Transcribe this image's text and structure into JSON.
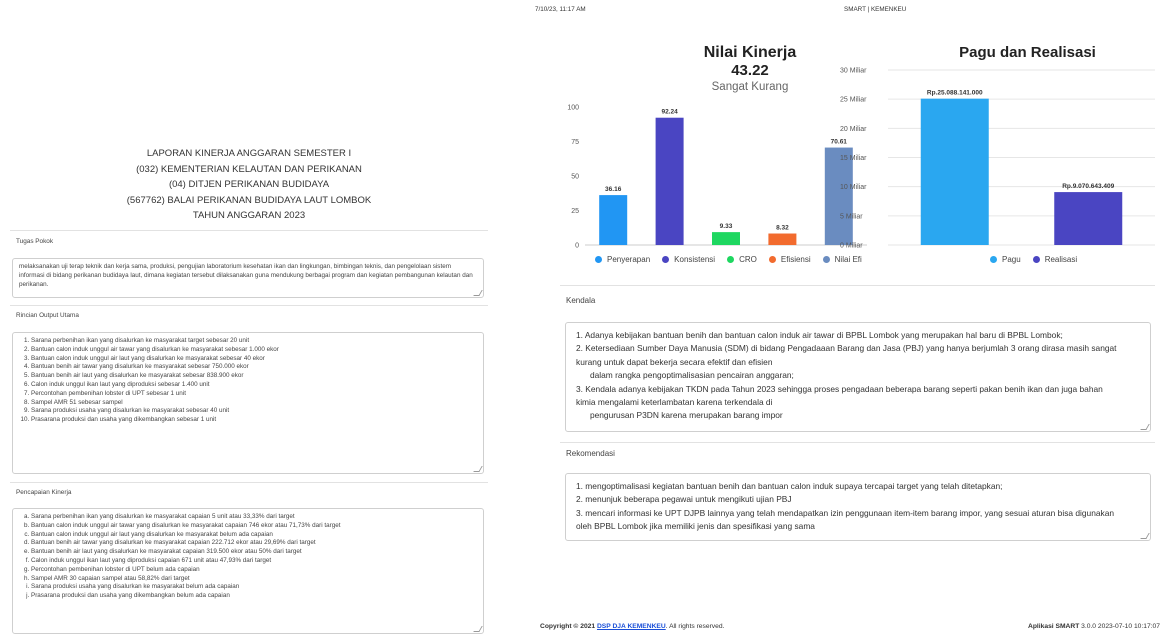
{
  "report": {
    "header": [
      "LAPORAN KINERJA ANGGARAN SEMESTER I",
      "(032) KEMENTERIAN KELAUTAN DAN PERIKANAN",
      "(04) DITJEN PERIKANAN BUDIDAYA",
      "(567762) BALAI PERIKANAN BUDIDAYA LAUT LOMBOK",
      "TAHUN ANGGARAN 2023"
    ],
    "tugas_label": "Tugas Pokok",
    "tugas_text": "melaksanakan uji terap teknik dan kerja sama, produksi, pengujian laboratorium kesehatan ikan dan lingkungan, bimbingan teknis, dan pengelolaan sistem informasi di bidang perikanan budidaya laut, dimana kegiatan tersebut dilaksanakan guna mendukung berbagai program dan kegiatan pembangunan kelautan dan perikanan.",
    "rincian_label": "Rincian Output Utama",
    "rincian_items": [
      "Sarana perbenihan ikan yang disalurkan ke masyarakat target sebesar 20 unit",
      "Bantuan calon induk unggul air tawar yang disalurkan ke masyarakat sebesar 1.000 ekor",
      "Bantuan calon induk unggul air laut yang disalurkan ke masyarakat sebesar 40 ekor",
      "Bantuan benih air tawar yang disalurkan ke masyarakat sebesar 750.000 ekor",
      "Bantuan benih air laut yang disalurkan ke masyarakat sebesar 838.900 ekor",
      "Calon induk unggul ikan laut yang diproduksi sebesar 1.400 unit",
      "Percontohan pembenihan lobster di UPT sebesar 1 unit",
      "Sampel AMR 51 sebesar sampel",
      "Sarana produksi usaha yang disalurkan ke masyarakat sebesar 40 unit",
      "Prasarana produksi dan usaha yang dikembangkan sebesar 1 unit"
    ],
    "pencapaian_label": "Pencapaian Kinerja",
    "pencapaian_items": [
      "Sarana perbenihan ikan yang disalurkan ke masyarakat capaian 5 unit atau 33,33% dari target",
      "Bantuan calon induk unggul air tawar yang disalurkan ke masyarakat capaian 746 ekor atau 71,73% dari target",
      "Bantuan calon induk unggul air laut yang disalurkan ke masyarakat belum ada capaian",
      "Bantuan benih air tawar yang disalurkan ke masyarakat capaian 222.712 ekor atau 29,69% dari target",
      "Bantuan benih air laut yang disalurkan ke masyarakat capaian 319.500 ekor atau 50% dari target",
      "Calon induk unggul ikan laut yang diproduksi capaian 671 unit atau 47,93% dari target",
      "Percontohan pembenihan lobster di UPT belum ada capaian",
      "Sampel AMR 30 capaian sampel atau 58,82% dari target",
      "Sarana produksi usaha yang disalurkan ke masyarakat belum ada capaian",
      "Prasarana produksi dan usaha yang dikembangkan belum ada capaian"
    ]
  },
  "topbar": {
    "timestamp": "7/10/23, 11:17 AM",
    "site": "SMART | KEMENKEU"
  },
  "nilai": {
    "title": "Nilai Kinerja",
    "score": "43.22",
    "category": "Sangat Kurang"
  },
  "pagu_title": "Pagu dan Realisasi",
  "chart_data": [
    {
      "type": "bar",
      "categories": [
        "Penyerapan",
        "Konsistensi",
        "CRO",
        "Efisiensi",
        "Nilai Efisiensi"
      ],
      "values": [
        0,
        36.16,
        92.24,
        9.33,
        8.32,
        70.61
      ],
      "series": [
        {
          "name": "Penyerapan",
          "value": 36.16,
          "label": "36.16",
          "color": "#2196f3"
        },
        {
          "name": "Konsistensi",
          "value": 92.24,
          "label": "92.24",
          "color": "#4a45c2"
        },
        {
          "name": "CRO",
          "value": 9.33,
          "label": "9.33",
          "color": "#1ed760"
        },
        {
          "name": "Efisiensi",
          "value": 8.32,
          "label": "8.32",
          "color": "#f26b2e"
        },
        {
          "name": "Nilai Efisiensi",
          "value": 70.61,
          "label": "70.61",
          "color": "#6a8cc0"
        }
      ],
      "legend_labels": [
        "Penyerapan",
        "Konsistensi",
        "CRO",
        "Efisiensi",
        "Nilai Efi"
      ],
      "yticks": [
        "0",
        "25",
        "50",
        "75",
        "100"
      ],
      "ylim": [
        0,
        100
      ]
    },
    {
      "type": "bar",
      "title": "Pagu dan Realisasi",
      "series": [
        {
          "name": "Pagu",
          "value": 25088141000,
          "label": "Rp.25.088.141.000",
          "color": "#2aa7f0"
        },
        {
          "name": "Realisasi",
          "value": 9070643409,
          "label": "Rp.9.070.643.409",
          "color": "#4a45c2"
        }
      ],
      "yticks": [
        "0 Miliar",
        "5 Miliar",
        "10 Miliar",
        "15 Miliar",
        "20 Miliar",
        "25 Miliar",
        "30 Miliar"
      ],
      "ylim": [
        0,
        30000000000
      ]
    }
  ],
  "kendala": {
    "label": "Kendala",
    "lines": [
      "1.   Adanya kebijakan bantuan benih dan bantuan calon induk air tawar di BPBL Lombok yang merupakan hal baru di BPBL Lombok;",
      "2.   Ketersediaan Sumber Daya Manusia (SDM) di bidang Pengadaaan Barang dan Jasa (PBJ) yang hanya berjumlah 3 orang dirasa masih sangat",
      "kurang untuk dapat bekerja secara efektif dan efisien",
      "      dalam rangka pengoptimalisasian pencairan anggaran;",
      "3.   Kendala adanya kebijakan TKDN pada Tahun 2023 sehingga proses pengadaan beberapa barang seperti pakan benih ikan dan juga bahan",
      "kimia mengalami keterlambatan karena terkendala di",
      "      pengurusan P3DN karena merupakan barang impor"
    ]
  },
  "rekomendasi": {
    "label": "Rekomendasi",
    "lines": [
      "1. mengoptimalisasi kegiatan bantuan benih dan bantuan calon induk supaya tercapai target yang telah ditetapkan;",
      "2. menunjuk beberapa pegawai untuk mengikuti ujian PBJ",
      "3. mencari informasi ke UPT DJPB lainnya yang telah mendapatkan izin penggunaan item-item barang impor, yang sesuai aturan bisa digunakan",
      "oleh BPBL Lombok jika memiliki jenis dan spesifikasi yang sama"
    ]
  },
  "footer": {
    "copyright": "Copyright © 2021",
    "link": "DSP DJA KEMENKEU",
    "rights": ". All rights reserved.",
    "app_label": "Aplikasi SMART",
    "version": "3.0.0 2023-07-10 10:17:07"
  }
}
